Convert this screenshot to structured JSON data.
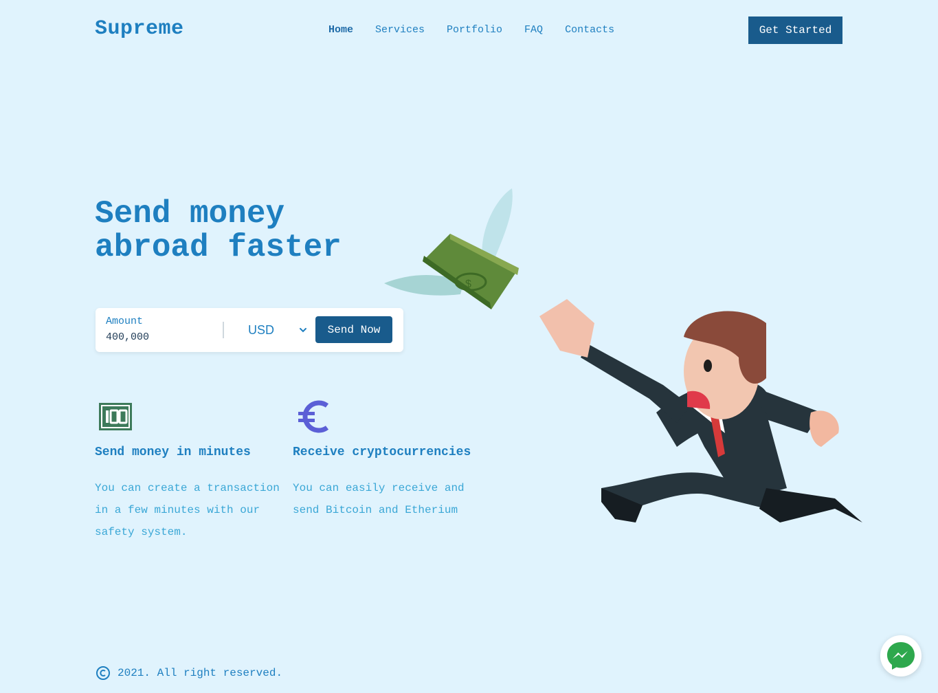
{
  "header": {
    "logo": "Supreme",
    "nav": [
      {
        "label": "Home",
        "active": true
      },
      {
        "label": "Services",
        "active": false
      },
      {
        "label": "Portfolio",
        "active": false
      },
      {
        "label": "FAQ",
        "active": false
      },
      {
        "label": "Contacts",
        "active": false
      }
    ],
    "cta_label": "Get Started"
  },
  "hero": {
    "title_line1": "Send money",
    "title_line2": "abroad faster",
    "form": {
      "amount_label": "Amount",
      "amount_value": "400,000",
      "currency": "USD",
      "send_label": "Send Now"
    }
  },
  "features": [
    {
      "icon": "banknote-100-icon",
      "title": "Send money in minutes",
      "text": "You can create a transaction in a few minutes with our safety system."
    },
    {
      "icon": "euro-icon",
      "title": "Receive cryptocurrencies",
      "text": "You can easily receive and send Bitcoin and Etherium"
    }
  ],
  "footer": {
    "copyright": "2021. All right reserved."
  },
  "colors": {
    "background": "#e0f3fd",
    "primary_text": "#1e7fc0",
    "button": "#195b8c",
    "feature_icon_green": "#3d7a5a",
    "feature_icon_purple": "#5b5fd6"
  }
}
